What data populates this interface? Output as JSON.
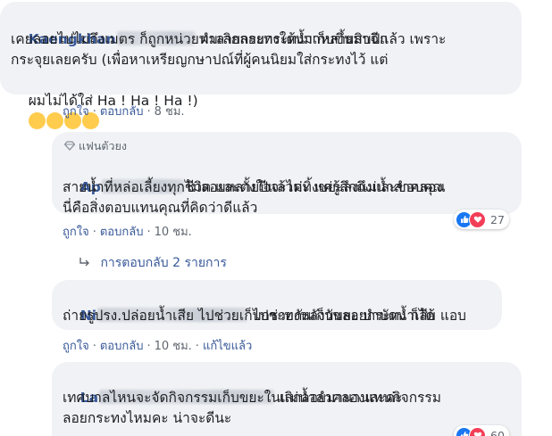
{
  "comments": [
    {
      "author": "Kaengkhan",
      "lines": [
        "ผมเลิกลอยกระทงมาหลายสิบปีแล้ว เพราะ",
        "เคยลอยไปไม่ถึงเมตร ก็ถูกหน่วยทำลายกระทงใต้น้ำเก็บขึ้นมาฉีก",
        "กระจุยเลยครับ (เพื่อหาเหรียญกษาปณ์ที่ผู้คนนิยมใส่กระทงไว้ แต่",
        "ผมไม่ได้ใส่ Ha ! Ha ! Ha !)"
      ],
      "emojis": [
        "rofl-emoji",
        "sweat-smile-emoji",
        "grin-emoji",
        "smile-emoji"
      ],
      "like": "ถูกใจ",
      "reply": "ตอบกลับ",
      "time": "8 ชม."
    },
    {
      "badge": "แฟนตัวยง",
      "author": "Ap",
      "lines": [
        "ไม่ลอยหลายปีแล้วค่ะ แค่รู้สึกถึงและขอบคุณ",
        "สายน้ำที่หล่อเลี้ยงทุกชีวิต และตั้งใจจะไม่ทิ้งขยะลงแม่น้ำลำคลอง",
        "นี่คือสิ่งตอบแทนคุณที่คิดว่าดีแล้ว"
      ],
      "reaction_count": "27",
      "like": "ถูกใจ",
      "reply": "ตอบกลับ",
      "time": "10 ชม.",
      "replies_label": "การตอบกลับ 2 รายการ"
    },
    {
      "author": "Ni",
      "lines": [
        "ไปช่วยกันเก็บขยะ บำบัดน้ำเสีย แอบ",
        "ถ่ายรูปรง.ปล่อยน้ำเสีย ไปช่วยเก็บกระทงหลังวันลอยกระทง ก็ได้"
      ],
      "like": "ถูกใจ",
      "reply": "ตอบกลับ",
      "time": "10 ชม.",
      "edited": "แก้ไขแล้ว"
    },
    {
      "author": "La",
      "lines": [
        "เลิกลอยมานานละค่ะ",
        "เทศบาลไหนจะจัดกิจกรรมเก็บขยะในแม่น้ำลำคลองแทนกิจกรรม",
        "ลอยกระทงไหมคะ น่าจะดีนะ"
      ],
      "reaction_count": "60"
    }
  ],
  "colors": {
    "bubble": "#f0f2f5",
    "link": "#385898",
    "meta": "#606770",
    "like_blue": "#1877f2",
    "love_red": "#f33e58"
  }
}
